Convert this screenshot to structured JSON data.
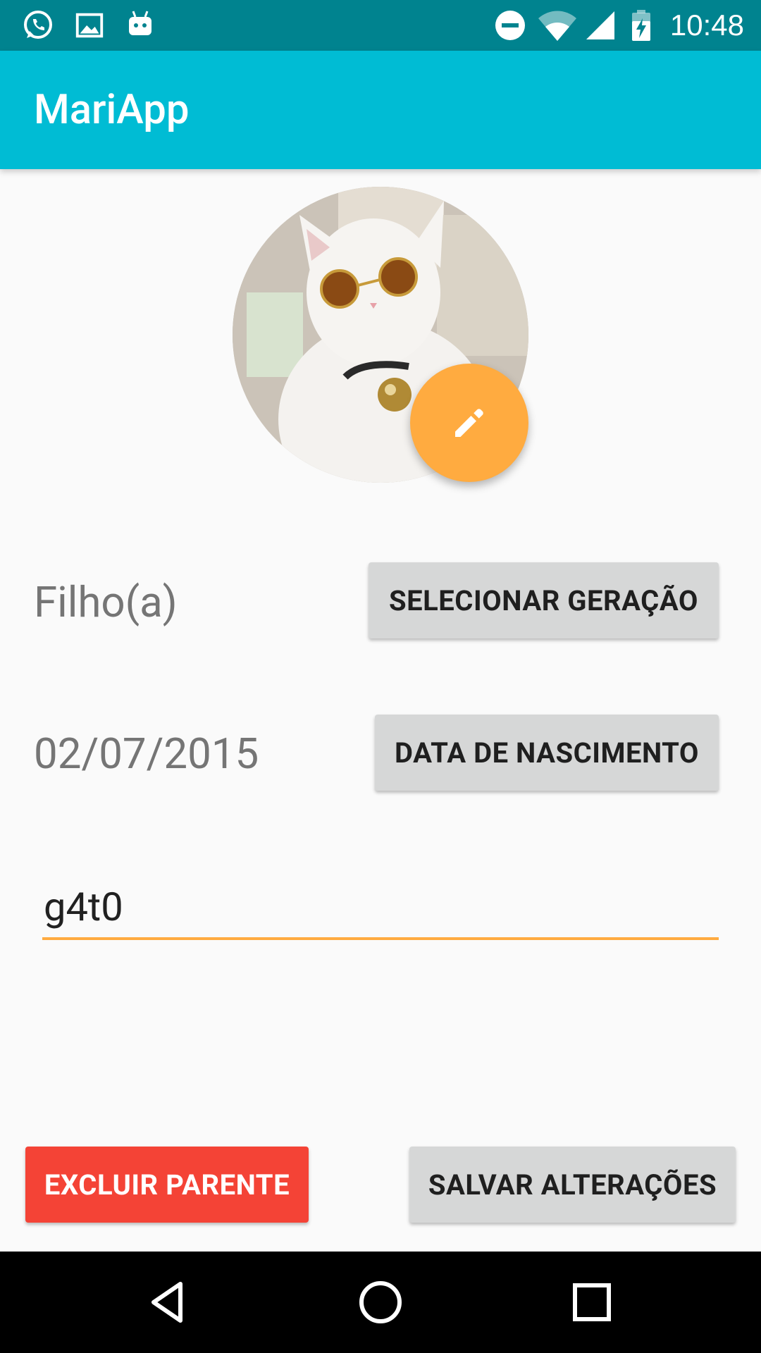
{
  "status_bar": {
    "time": "10:48",
    "left_icons": [
      "whatsapp-icon",
      "gallery-icon",
      "android-icon"
    ],
    "right_icons": [
      "do-not-disturb-icon",
      "wifi-icon",
      "cell-signal-icon",
      "battery-charging-icon"
    ]
  },
  "toolbar": {
    "title": "MariApp",
    "color": "#00bcd4"
  },
  "profile": {
    "photo_description_icon": "cat-photo",
    "edit_icon": "pencil-icon",
    "fab_color": "#ffab40"
  },
  "generation": {
    "value": "Filho(a)",
    "button_label": "SELECIONAR GERAÇÃO"
  },
  "birthdate": {
    "value": "02/07/2015",
    "button_label": "DATA DE NASCIMENTO"
  },
  "name_field": {
    "value": "g4t0",
    "accent_color": "#ffab40"
  },
  "actions": {
    "delete_label": "EXCLUIR PARENTE",
    "delete_color": "#f44336",
    "save_label": "SALVAR ALTERAÇÕES"
  },
  "nav_bar": {
    "icons": [
      "back-icon",
      "home-icon",
      "recents-icon"
    ]
  }
}
